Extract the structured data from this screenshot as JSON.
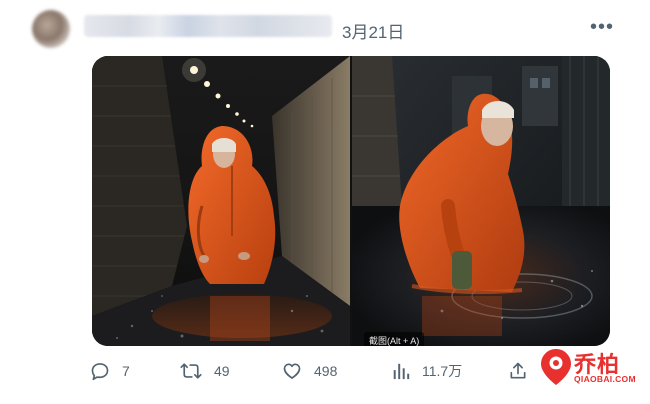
{
  "post": {
    "date": "3月21日",
    "more_icon": "ellipsis-icon"
  },
  "media": {
    "alt_badge": "截图(Alt + A)"
  },
  "actions": {
    "reply_count": "7",
    "retweet_count": "49",
    "like_count": "498",
    "views_count": "11.7万"
  },
  "watermark": {
    "brand": "乔柏",
    "domain": "QIAOBAI.COM",
    "color": "#e8302f"
  },
  "colors": {
    "muted_text": "#536471",
    "raincoat": "#e2561f"
  }
}
